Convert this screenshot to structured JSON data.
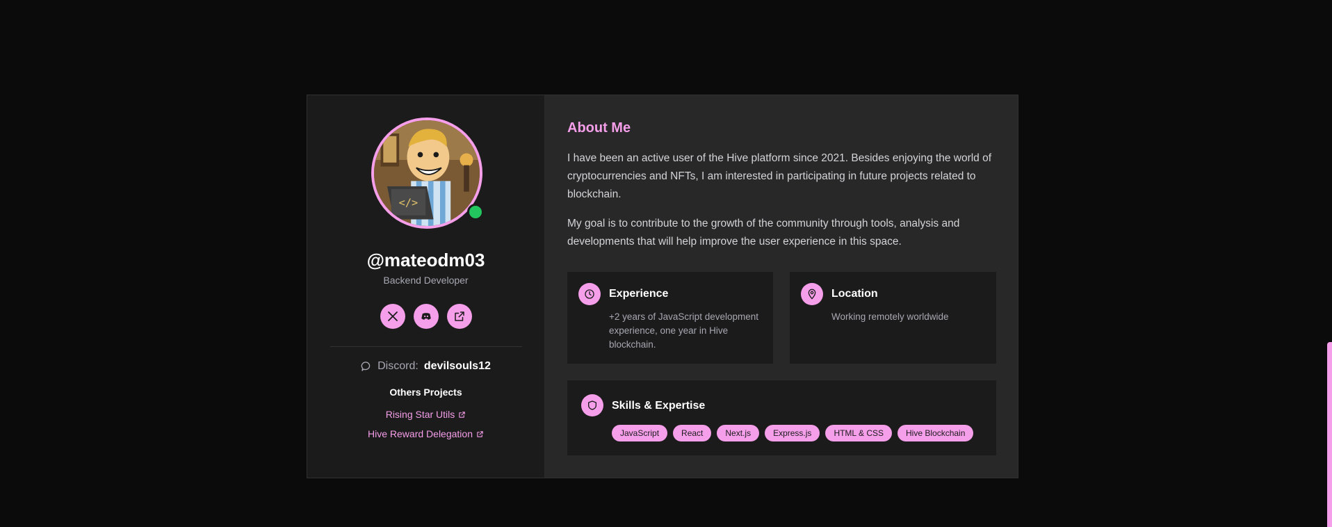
{
  "profile": {
    "username": "@mateodm03",
    "role": "Backend Developer",
    "status": "online",
    "social_icons": [
      "x-icon",
      "discord-icon",
      "external-link-icon"
    ],
    "discord_label": "Discord:",
    "discord_handle": "devilsouls12",
    "projects_title": "Others Projects",
    "projects": [
      {
        "label": "Rising Star Utils"
      },
      {
        "label": "Hive Reward Delegation"
      }
    ]
  },
  "about": {
    "title": "About Me",
    "paragraphs": [
      "I have been an active user of the Hive platform since 2021. Besides enjoying the world of cryptocurrencies and NFTs, I am interested in participating in future projects related to blockchain.",
      "My goal is to contribute to the growth of the community through tools, analysis and developments that will help improve the user experience in this space."
    ]
  },
  "experience": {
    "title": "Experience",
    "text": "+2 years of JavaScript development experience, one year in Hive blockchain.",
    "icon": "clock-icon"
  },
  "location": {
    "title": "Location",
    "text": "Working remotely worldwide",
    "icon": "map-pin-icon"
  },
  "skills": {
    "title": "Skills & Expertise",
    "icon": "shield-icon",
    "tags": [
      "JavaScript",
      "React",
      "Next.js",
      "Express.js",
      "HTML & CSS",
      "Hive Blockchain"
    ]
  },
  "colors": {
    "accent": "#f59ee9",
    "background": "#0b0b0b",
    "card_left": "#1b1b1b",
    "card_right": "#282828",
    "status_online": "#22c55e"
  }
}
